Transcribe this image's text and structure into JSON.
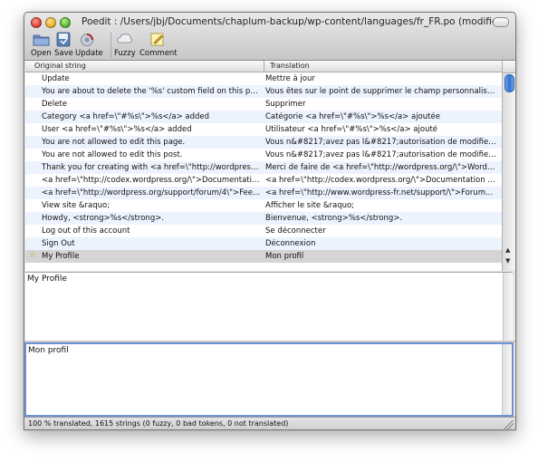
{
  "window": {
    "title": "Poedit : /Users/jbj/Documents/chaplum-backup/wp-content/languages/fr_FR.po (modified)"
  },
  "toolbar": {
    "buttons": [
      {
        "label": "Open",
        "icon": "folder-icon"
      },
      {
        "label": "Save",
        "icon": "save-icon"
      },
      {
        "label": "Update",
        "icon": "update-icon"
      },
      {
        "label": "Fuzzy",
        "icon": "fuzzy-icon"
      },
      {
        "label": "Comment",
        "icon": "comment-icon"
      }
    ]
  },
  "list": {
    "columns": [
      "Original string",
      "Translation"
    ],
    "rows": [
      {
        "original": "Update",
        "translation": "Mettre à jour"
      },
      {
        "original": "You are about to delete the '%s' custom field on this post....",
        "translation": "Vous êtes sur le point de supprimer le champ personnalisé '%..."
      },
      {
        "original": "Delete",
        "translation": "Supprimer"
      },
      {
        "original": "Category <a href=\\\"#%s\\\">%s</a> added",
        "translation": "Catégorie <a href=\\\"#%s\\\">%s</a> ajoutée"
      },
      {
        "original": "User <a href=\\\"#%s\\\">%s</a> added",
        "translation": "Utilisateur <a href=\\\"#%s\\\">%s</a> ajouté"
      },
      {
        "original": "You are not allowed to edit this page.",
        "translation": "Vous n&#8217;avez pas l&#8217;autorisation de modifier cet..."
      },
      {
        "original": "You are not allowed to edit this post.",
        "translation": "Vous n&#8217;avez pas l&#8217;autorisation de modifier cet..."
      },
      {
        "original": "Thank you for creating with <a href=\\\"http://wordpress.o...",
        "translation": "Merci de faire de <a href=\\\"http://wordpress.org/\\\">WordPr..."
      },
      {
        "original": "<a href=\\\"http://codex.wordpress.org/\\\">Documentatio...",
        "translation": "<a href=\\\"http://codex.wordpress.org/\\\">Documentation (a..."
      },
      {
        "original": "<a href=\\\"http://wordpress.org/support/forum/4\\\">Fee...",
        "translation": "<a href=\\\"http://www.wordpress-fr.net/support/\\\">Forum..."
      },
      {
        "original": "View site &raquo;",
        "translation": "Afficher le site &raquo;"
      },
      {
        "original": "Howdy, <strong>%s</strong>.",
        "translation": "Bienvenue, <strong>%s</strong>."
      },
      {
        "original": "Log out of this account",
        "translation": "Se déconnecter"
      },
      {
        "original": "Sign Out",
        "translation": "Déconnexion"
      },
      {
        "original": "My Profile",
        "translation": "Mon profil",
        "selected": true
      }
    ]
  },
  "editor": {
    "original_text": "My Profile",
    "translation_text": "Mon profil"
  },
  "statusbar": {
    "text": "100 % translated, 1615 strings (0 fuzzy, 0 bad tokens, 0 not translated)"
  },
  "colors": {
    "selected_row": "#d4d4d4",
    "alternate_row": "#edf3fe",
    "focus_border": "#6d93d4",
    "fuzzy_star": "#c9a400"
  }
}
